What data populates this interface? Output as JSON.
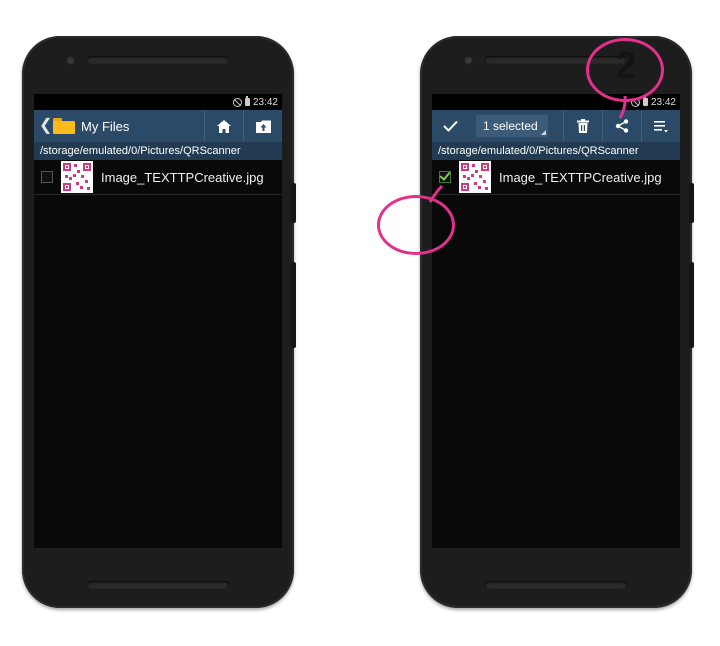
{
  "status": {
    "time": "23:42"
  },
  "left_screen": {
    "title": "My Files",
    "path": "/storage/emulated/0/Pictures/QRScanner",
    "files": [
      {
        "name": "Image_TEXTTPCreative.jpg",
        "checked": false
      }
    ]
  },
  "right_screen": {
    "selection_label": "1 selected",
    "path": "/storage/emulated/0/Pictures/QRScanner",
    "files": [
      {
        "name": "Image_TEXTTPCreative.jpg",
        "checked": true
      }
    ]
  },
  "annotation": {
    "step_number": "2",
    "color": "#e2318c"
  },
  "colors": {
    "actionbar": "#2b4a67",
    "pathbar": "#223b52",
    "accent": "#e2318c"
  },
  "icons": [
    "back-chevron-icon",
    "folder-icon",
    "home-icon",
    "folder-upload-icon",
    "check-icon",
    "trash-icon",
    "share-icon",
    "overflow-menu-icon",
    "blocked-icon",
    "battery-icon"
  ]
}
